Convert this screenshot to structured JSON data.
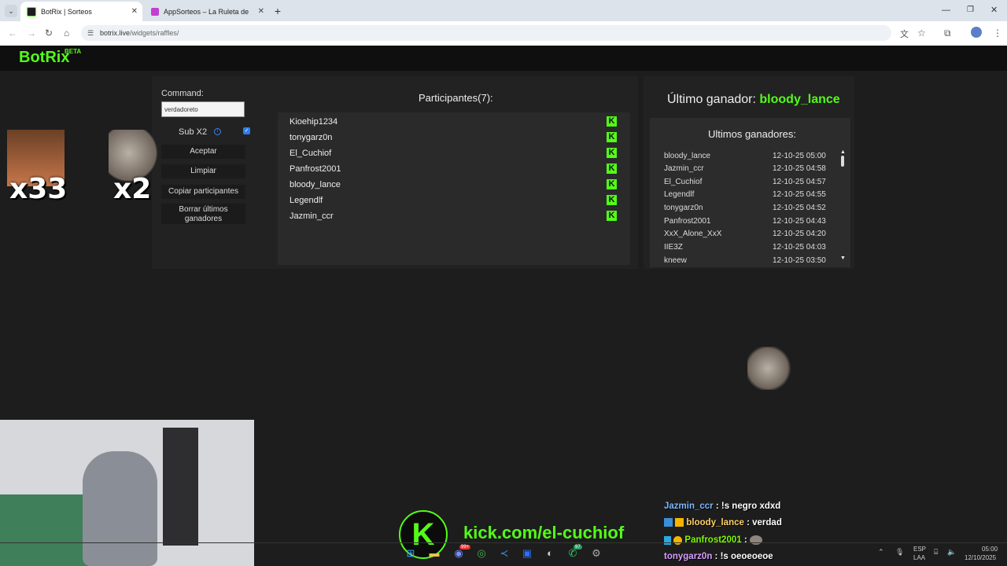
{
  "browser": {
    "tabs": [
      {
        "label": "BotRix | Sorteos"
      },
      {
        "label": "AppSorteos – La Ruleta de la Suerte"
      }
    ],
    "url_host": "botrix.live",
    "url_path": "/widgets/raffles/"
  },
  "site": {
    "logo": "BotRix",
    "badge": "BETA"
  },
  "raffle": {
    "command_label": "Command:",
    "command_value": "verdadoreto",
    "subx2_label": "Sub X2",
    "subx2_checked": true,
    "buttons": {
      "accept": "Aceptar",
      "clear": "Limpiar",
      "copy": "Copiar participantes",
      "delete_last": "Borrar últimos ganadores"
    },
    "participants_title": "Participantes(7):",
    "participants": [
      "Kioehip1234",
      "tonygarz0n",
      "El_Cuchiof",
      "Panfrost2001",
      "bloody_lance",
      "Legendlf",
      "Jazmin_ccr"
    ],
    "platform_badge": "K"
  },
  "winners": {
    "last_label": "Último ganador:",
    "last_name": "bloody_lance",
    "list_title": "Ultimos ganadores:",
    "rows": [
      {
        "name": "bloody_lance",
        "time": "12-10-25 05:00"
      },
      {
        "name": "Jazmin_ccr",
        "time": "12-10-25 04:58"
      },
      {
        "name": "El_Cuchiof",
        "time": "12-10-25 04:57"
      },
      {
        "name": "Legendlf",
        "time": "12-10-25 04:55"
      },
      {
        "name": "tonygarz0n",
        "time": "12-10-25 04:52"
      },
      {
        "name": "Panfrost2001",
        "time": "12-10-25 04:43"
      },
      {
        "name": "XxX_Alone_XxX",
        "time": "12-10-25 04:20"
      },
      {
        "name": "IIE3Z",
        "time": "12-10-25 04:03"
      },
      {
        "name": "kneew",
        "time": "12-10-25 03:50"
      }
    ]
  },
  "overlay": {
    "multipliers": [
      "x33",
      "x2"
    ],
    "kick_letter": "K",
    "kick_url": "kick.com/el-cuchiof"
  },
  "chat": [
    {
      "user": "Jazmin_ccr",
      "msg": ": !s negro xdxd",
      "color": "#7cb8ff"
    },
    {
      "user": "bloody_lance",
      "msg": ": verdad",
      "color": "#ffd166"
    },
    {
      "user": "Panfrost2001",
      "msg": ":",
      "color": "#7CFC00"
    },
    {
      "user": "tonygarz0n",
      "msg": ": !s oeoeoeoe",
      "color": "#d9a0ff"
    }
  ],
  "taskbar": {
    "lang": "ESP",
    "lang_sub": "LAA",
    "time": "05:00",
    "date": "12/10/2025",
    "discord_badge": "99+",
    "whatsapp_badge": "97"
  },
  "colors": {
    "kick_green": "#53fc18",
    "panel": "#222222",
    "background": "#1d1d1d"
  }
}
